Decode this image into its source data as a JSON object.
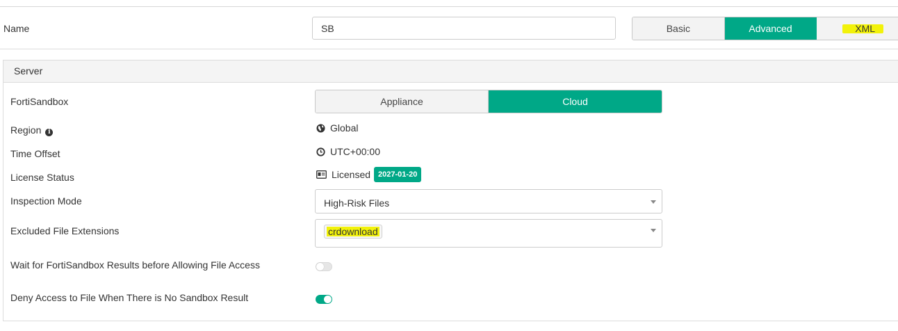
{
  "name_field": {
    "label": "Name",
    "value": "SB"
  },
  "mode_tabs": {
    "items": [
      "Basic",
      "Advanced",
      "XML"
    ],
    "selected": "Advanced"
  },
  "server_section": {
    "title": "Server",
    "fortisandbox": {
      "label": "FortiSandbox",
      "options": [
        "Appliance",
        "Cloud"
      ],
      "selected": "Cloud"
    },
    "region": {
      "label": "Region",
      "info_icon": "info-circle-icon",
      "icon": "globe-icon",
      "value": "Global"
    },
    "time_offset": {
      "label": "Time Offset",
      "icon": "clock-icon",
      "value": "UTC+00:00"
    },
    "license_status": {
      "label": "License Status",
      "icon": "id-card-icon",
      "value": "Licensed",
      "badge": "2027-01-20"
    },
    "inspection_mode": {
      "label": "Inspection Mode",
      "value": "High-Risk Files"
    },
    "excluded_extensions": {
      "label": "Excluded File Extensions",
      "tags": [
        "crdownload"
      ]
    },
    "wait_for_results": {
      "label": "Wait for FortiSandbox Results before Allowing File Access",
      "enabled": false
    },
    "deny_access": {
      "label": "Deny Access to File When There is No Sandbox Result",
      "enabled": true
    }
  },
  "colors": {
    "accent": "#00a887",
    "highlight": "#f2f20a",
    "border": "#cccccc",
    "header_bg": "#f4f4f4"
  }
}
